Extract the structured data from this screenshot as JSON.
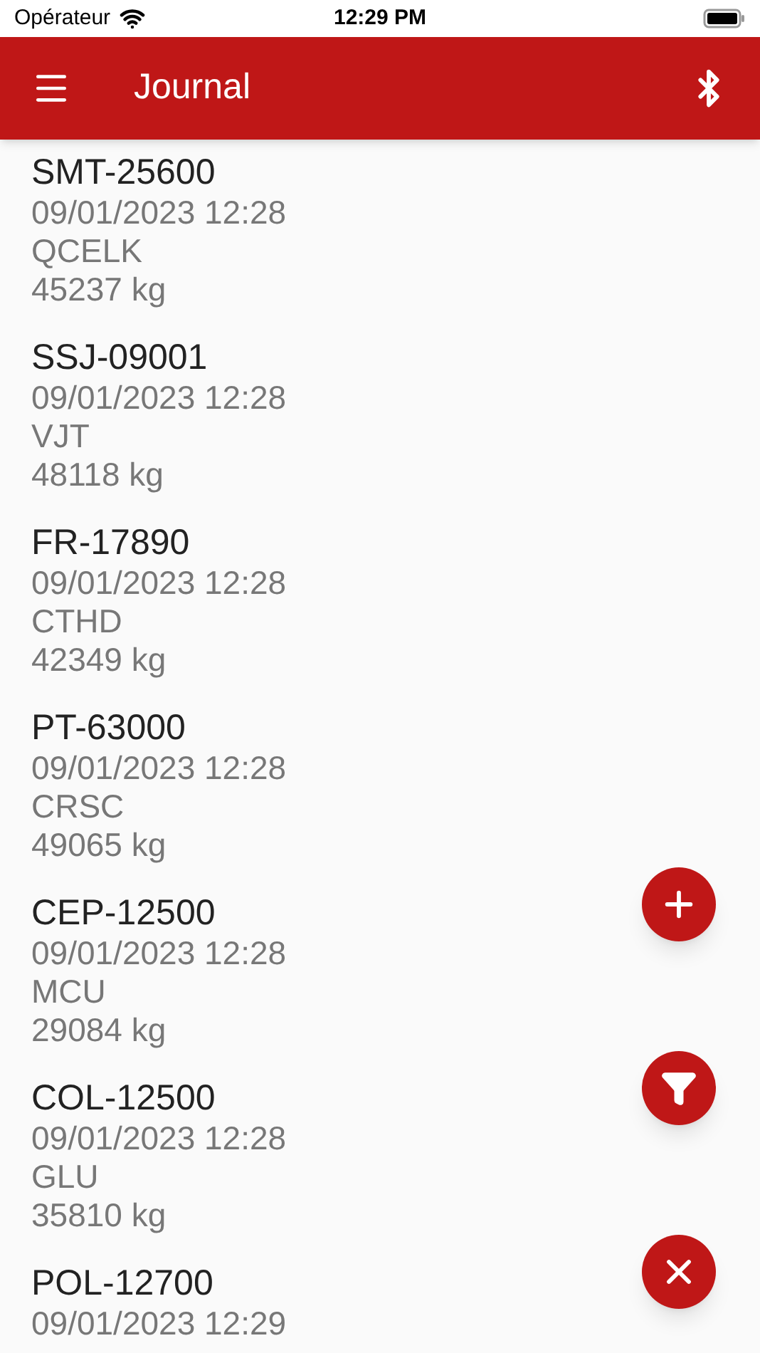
{
  "status_bar": {
    "carrier": "Opérateur",
    "time": "12:29 PM"
  },
  "app_bar": {
    "title": "Journal"
  },
  "entries": [
    {
      "id": "SMT-25600",
      "date": "09/01/2023 12:28",
      "code": "QCELK",
      "weight": "45237 kg"
    },
    {
      "id": "SSJ-09001",
      "date": "09/01/2023 12:28",
      "code": "VJT",
      "weight": "48118 kg"
    },
    {
      "id": "FR-17890",
      "date": "09/01/2023 12:28",
      "code": "CTHD",
      "weight": "42349 kg"
    },
    {
      "id": "PT-63000",
      "date": "09/01/2023 12:28",
      "code": "CRSC",
      "weight": "49065 kg"
    },
    {
      "id": "CEP-12500",
      "date": "09/01/2023 12:28",
      "code": "MCU",
      "weight": "29084 kg"
    },
    {
      "id": "COL-12500",
      "date": "09/01/2023 12:28",
      "code": "GLU",
      "weight": "35810 kg"
    },
    {
      "id": "POL-12700",
      "date": "09/01/2023 12:29"
    }
  ],
  "fabs": [
    {
      "kind": "add"
    },
    {
      "kind": "filter"
    },
    {
      "kind": "clear"
    }
  ]
}
